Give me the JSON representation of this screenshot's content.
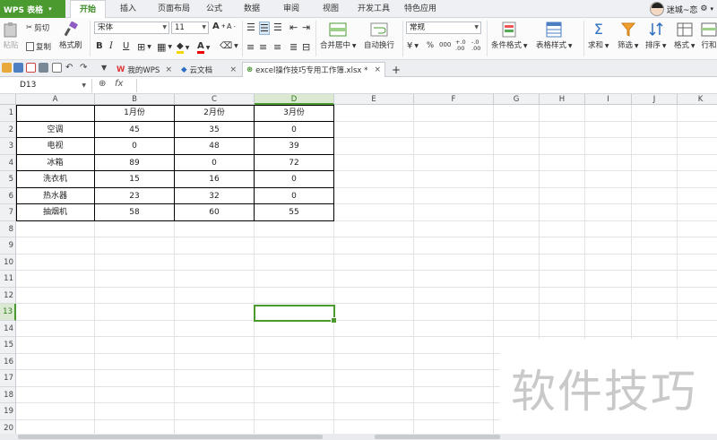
{
  "app": {
    "logo_label": "WPS 表格"
  },
  "menu": {
    "items": [
      "开始",
      "插入",
      "页面布局",
      "公式",
      "数据",
      "审阅",
      "视图",
      "开发工具",
      "特色应用"
    ],
    "active": "开始"
  },
  "user": {
    "name": "迷城~恋"
  },
  "ribbon": {
    "paste": "粘贴",
    "cut": "剪切",
    "copy": "复制",
    "format_painter": "格式刷",
    "font_name": "宋体",
    "font_size": "11",
    "bold": "B",
    "italic": "I",
    "underline": "U",
    "font_grow": "A",
    "font_shrink": "A",
    "merge_center": "合并居中",
    "wrap_text": "自动换行",
    "number_format": "常规",
    "percent": "%",
    "thousands": "000",
    "inc_decimal": "+.0 .00",
    "dec_decimal": "-.0 .00",
    "conditional_format": "条件格式",
    "table_style": "表格样式",
    "sum": "求和",
    "filter": "筛选",
    "sort": "排序",
    "format": "格式",
    "rows_cols": "行和"
  },
  "tabs": [
    {
      "label": "我的WPS",
      "icon": "wps-icon"
    },
    {
      "label": "云文档",
      "icon": "cloud-icon"
    },
    {
      "label": "excel操作技巧专用工作簿.xlsx *",
      "icon": "excel-file-icon"
    }
  ],
  "formula_bar": {
    "name_box": "D13",
    "fx_label": "fx",
    "formula": ""
  },
  "columns": [
    "A",
    "B",
    "C",
    "D",
    "E",
    "F",
    "G",
    "H",
    "I",
    "J",
    "K"
  ],
  "selected_column": "D",
  "rows": [
    "1",
    "2",
    "3",
    "4",
    "5",
    "6",
    "7",
    "8",
    "9",
    "10",
    "11",
    "12",
    "13",
    "14",
    "15",
    "16",
    "17",
    "18",
    "19",
    "20"
  ],
  "selected_row": "13",
  "table": {
    "header": [
      "",
      "1月份",
      "2月份",
      "3月份"
    ],
    "rows": [
      [
        "空调",
        "45",
        "35",
        "0"
      ],
      [
        "电视",
        "0",
        "48",
        "39"
      ],
      [
        "冰箱",
        "89",
        "0",
        "72"
      ],
      [
        "洗衣机",
        "15",
        "16",
        "0"
      ],
      [
        "热水器",
        "23",
        "32",
        "0"
      ],
      [
        "抽烟机",
        "58",
        "60",
        "55"
      ]
    ]
  },
  "watermark": "软件技巧"
}
